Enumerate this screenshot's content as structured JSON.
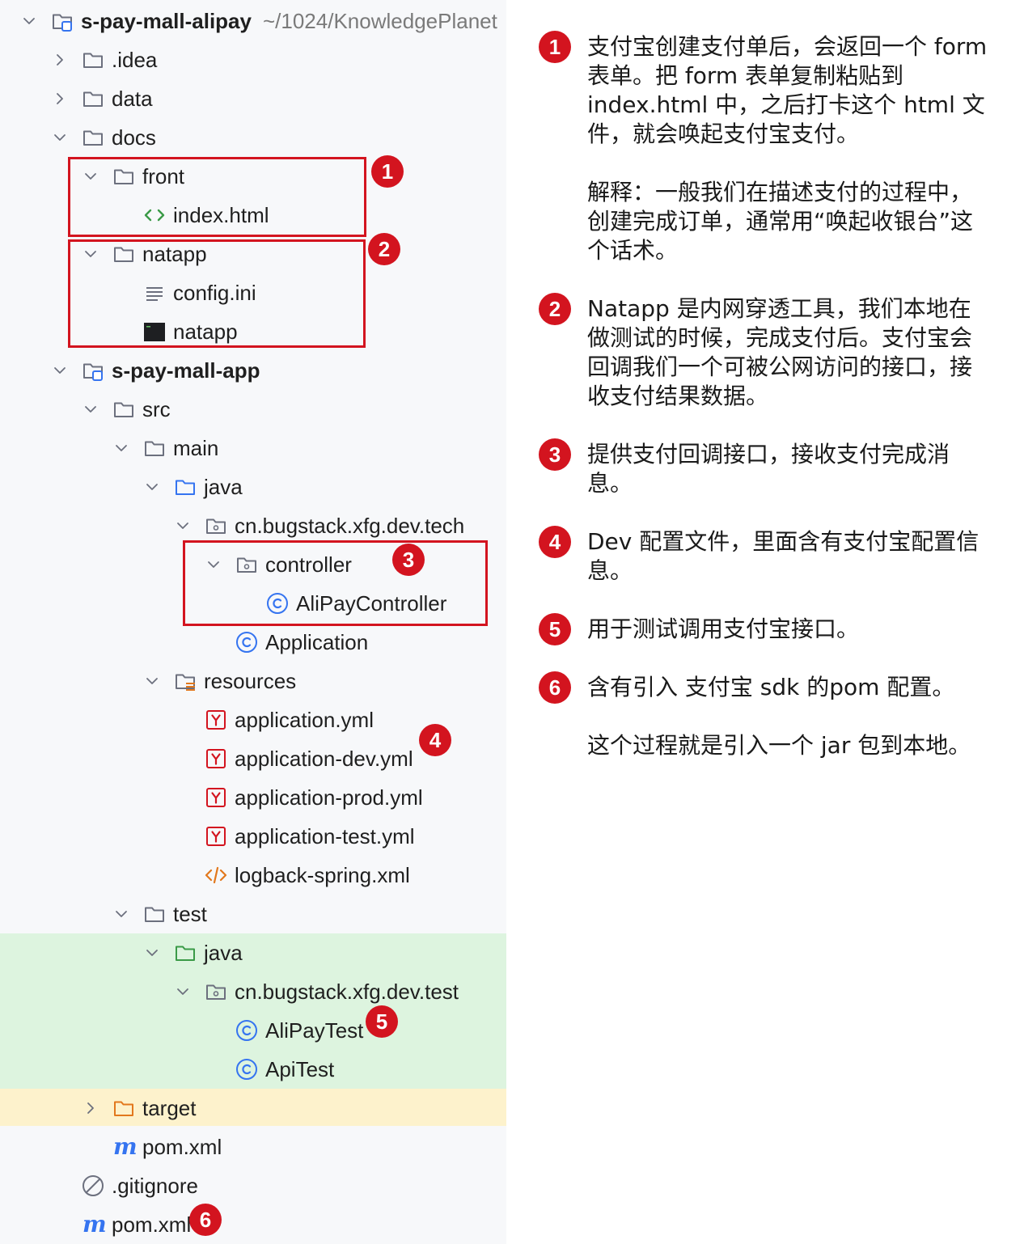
{
  "project_tree": {
    "rows": [
      {
        "label": "s-pay-mall-alipay",
        "path": "~/1024/KnowledgePlanet"
      },
      {
        "label": ".idea"
      },
      {
        "label": "data"
      },
      {
        "label": "docs"
      },
      {
        "label": "front"
      },
      {
        "label": "index.html"
      },
      {
        "label": "natapp"
      },
      {
        "label": "config.ini"
      },
      {
        "label": "natapp"
      },
      {
        "label": "s-pay-mall-app"
      },
      {
        "label": "src"
      },
      {
        "label": "main"
      },
      {
        "label": "java"
      },
      {
        "label": "cn.bugstack.xfg.dev.tech"
      },
      {
        "label": "controller"
      },
      {
        "label": "AliPayController"
      },
      {
        "label": "Application"
      },
      {
        "label": "resources"
      },
      {
        "label": "application.yml"
      },
      {
        "label": "application-dev.yml"
      },
      {
        "label": "application-prod.yml"
      },
      {
        "label": "application-test.yml"
      },
      {
        "label": "logback-spring.xml"
      },
      {
        "label": "test"
      },
      {
        "label": "java"
      },
      {
        "label": "cn.bugstack.xfg.dev.test"
      },
      {
        "label": "AliPayTest"
      },
      {
        "label": "ApiTest"
      },
      {
        "label": "target"
      },
      {
        "label": "pom.xml"
      },
      {
        "label": ".gitignore"
      },
      {
        "label": "pom.xml"
      }
    ],
    "badges": [
      "1",
      "2",
      "3",
      "4",
      "5",
      "6"
    ]
  },
  "notes": [
    {
      "num": "1",
      "paragraphs": [
        "支付宝创建支付单后，会返回一个 form 表单。把 form 表单复制粘贴到 index.html 中，之后打卡这个 html 文件，就会唤起支付宝支付。",
        "解释：一般我们在描述支付的过程中，创建完成订单，通常用“唤起收银台”这个话术。"
      ]
    },
    {
      "num": "2",
      "paragraphs": [
        "Natapp 是内网穿透工具，我们本地在做测试的时候，完成支付后。支付宝会回调我们一个可被公网访问的接口，接收支付结果数据。"
      ]
    },
    {
      "num": "3",
      "paragraphs": [
        "提供支付回调接口，接收支付完成消息。"
      ]
    },
    {
      "num": "4",
      "paragraphs": [
        "Dev 配置文件，里面含有支付宝配置信息。"
      ]
    },
    {
      "num": "5",
      "paragraphs": [
        "用于测试调用支付宝接口。"
      ]
    },
    {
      "num": "6",
      "paragraphs": [
        "含有引入 支付宝 sdk 的pom 配置。",
        "这个过程就是引入一个 jar 包到本地。"
      ]
    }
  ],
  "colors": {
    "accent_red": "#d3141f",
    "test_bg": "#ddf4df",
    "excluded_bg": "#fdf2cc"
  }
}
